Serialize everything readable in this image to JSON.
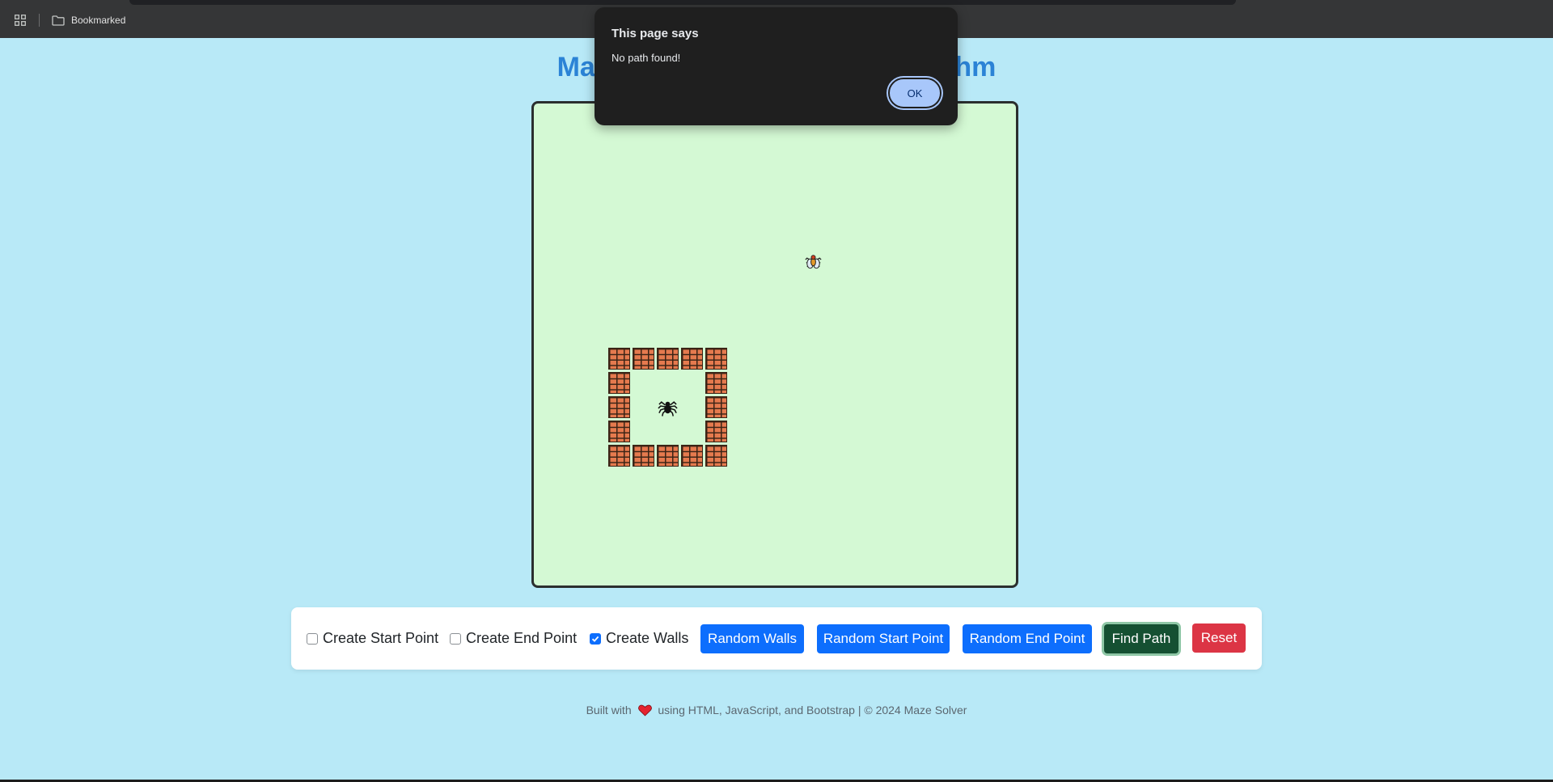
{
  "browser": {
    "bookmark_folder": "Bookmarked"
  },
  "page": {
    "title": "Maze Solver using BFS Algorithm"
  },
  "maze": {
    "grid_size": 20,
    "start_cell": {
      "row": 12,
      "col": 5,
      "icon": "spider-icon"
    },
    "end_cell": {
      "row": 6,
      "col": 11,
      "icon": "fly-icon"
    },
    "walls": [
      [
        10,
        3
      ],
      [
        10,
        4
      ],
      [
        10,
        5
      ],
      [
        10,
        6
      ],
      [
        10,
        7
      ],
      [
        11,
        3
      ],
      [
        11,
        7
      ],
      [
        12,
        3
      ],
      [
        12,
        7
      ],
      [
        13,
        3
      ],
      [
        13,
        7
      ],
      [
        14,
        3
      ],
      [
        14,
        4
      ],
      [
        14,
        5
      ],
      [
        14,
        6
      ],
      [
        14,
        7
      ]
    ]
  },
  "controls": {
    "create_start_label": "Create Start Point",
    "create_start_checked": false,
    "create_end_label": "Create End Point",
    "create_end_checked": false,
    "create_walls_label": "Create Walls",
    "create_walls_checked": true,
    "random_walls_label": "Random Walls",
    "random_start_label": "Random Start Point",
    "random_end_label": "Random End Point",
    "find_path_label": "Find Path",
    "reset_label": "Reset"
  },
  "footer": {
    "prefix": "Built with",
    "suffix": "using HTML, JavaScript, and Bootstrap | © 2024 Maze Solver"
  },
  "dialog": {
    "title": "This page says",
    "message": "No path found!",
    "ok_label": "OK"
  },
  "colors": {
    "page_bg": "#b8e9f7",
    "title": "#2b83d6",
    "maze_bg": "#d4f9d4",
    "primary": "#0d6efd",
    "success": "#155032",
    "danger": "#dc3545"
  }
}
